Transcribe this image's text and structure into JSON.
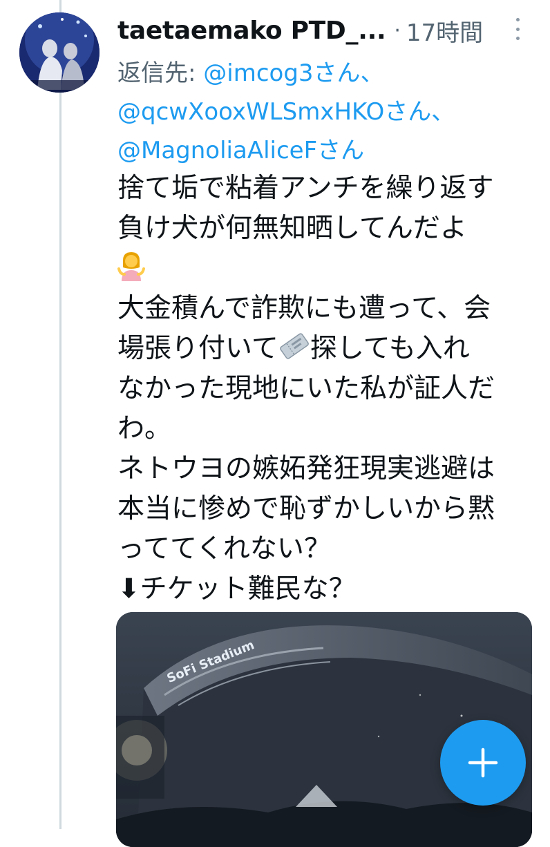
{
  "tweet": {
    "display_name": "taetaemako PTD_...",
    "separator": "·",
    "time": "17時間",
    "reply_prefix": "返信先: ",
    "mentions": [
      "@imcog3さん、",
      "@qcwXooxWLSmxHKOさん、",
      "@MagnoliaAliceFさん"
    ],
    "text": {
      "line1": "捨て垢で粘着アンチを繰り返す",
      "line2": "負け犬が何無知晒してんだよ",
      "line3": "大金積んで詐欺にも遭って、会",
      "line4a": "場張り付いて",
      "line4b": "探しても入れ",
      "line5": "なかった現地にいた私が証人だ",
      "line6": "わ。",
      "line7": "ネトウヨの嫉妬発狂現実逃避は",
      "line8": "本当に惨めで恥ずかしいから黙",
      "line9": "っててくれない？",
      "line10": "⬇チケット難民な？"
    },
    "emojis": [
      "person-shrugging-icon",
      "ticket-icon"
    ],
    "media": {
      "type": "photo",
      "signage": "SoFi Stadium"
    }
  },
  "fab": {
    "icon": "plus-icon",
    "color": "#1d9bf0"
  },
  "colors": {
    "accent": "#1d9bf0",
    "secondary_text": "#536471",
    "thread_line": "#cfd9de"
  }
}
